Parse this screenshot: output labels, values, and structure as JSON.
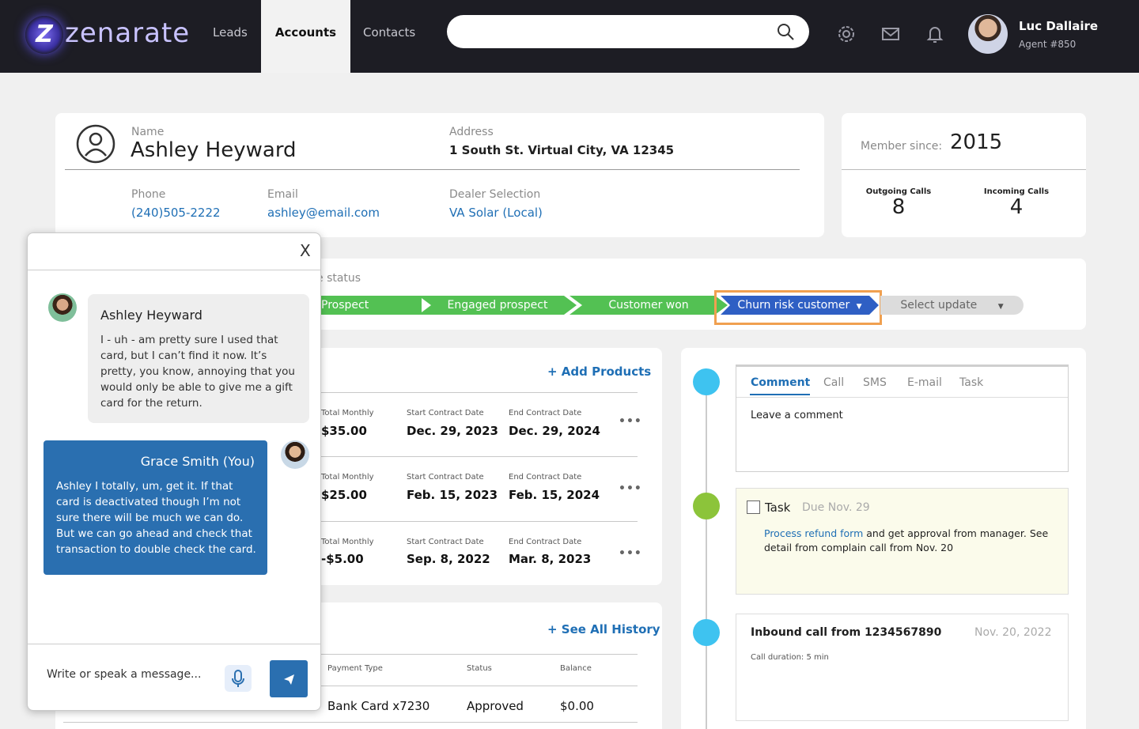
{
  "app": {
    "logo_letter": "Z",
    "name": "zenarate"
  },
  "nav": {
    "tabs": [
      "Leads",
      "Accounts",
      "Contacts"
    ],
    "active": "Accounts"
  },
  "search": {
    "placeholder": ""
  },
  "icons": {
    "search": "search-icon",
    "settings": "gear-icon",
    "mail": "mail-icon",
    "notifications": "bell-icon",
    "send": "send-icon",
    "mic": "microphone-icon",
    "more": "more-icon",
    "add": "plus-icon"
  },
  "user": {
    "name": "Luc Dallaire",
    "agent": "Agent #850"
  },
  "customer": {
    "name_label": "Name",
    "name": "Ashley Heyward",
    "address_label": "Address",
    "address": "1 South St. Virtual City, VA 12345",
    "phone_label": "Phone",
    "phone": "(240)505-2222",
    "email_label": "Email",
    "email": "ashley@email.com",
    "dealer_label": "Dealer Selection",
    "dealer": "VA Solar (Local)"
  },
  "stats": {
    "member_label": "Member since:",
    "member_year": "2015",
    "outgoing_label": "Outgoing Calls",
    "outgoing": "8",
    "incoming_label": "Incoming Calls",
    "incoming": "4"
  },
  "pipeline": {
    "label_fragment": "e status",
    "stages": [
      "Prospect",
      "Engaged prospect",
      "Customer won",
      "Churn risk customer",
      "Select update"
    ]
  },
  "products": {
    "add_label": "Add Products",
    "rows": [
      {
        "monthly_label": "Total Monthly",
        "monthly": "$35.00",
        "start_label": "Start Contract Date",
        "start": "Dec. 29, 2023",
        "end_label": "End Contract Date",
        "end": "Dec. 29, 2024"
      },
      {
        "monthly_label": "Total Monthly",
        "monthly": "$25.00",
        "start_label": "Start Contract Date",
        "start": "Feb. 15, 2023",
        "end_label": "End Contract Date",
        "end": "Feb. 15, 2024"
      },
      {
        "monthly_label": "Total Monthly",
        "monthly": "-$5.00",
        "start_label": "Start Contract Date",
        "start": "Sep. 8, 2022",
        "end_label": "End Contract Date",
        "end": "Mar. 8, 2023"
      }
    ]
  },
  "history": {
    "see_all": "See All History",
    "headers": [
      "Payment Type",
      "Status",
      "Balance"
    ],
    "row": [
      "Bank Card x7230",
      "Approved",
      "$0.00"
    ]
  },
  "activity": {
    "tabs": [
      "Comment",
      "Call",
      "SMS",
      "E-mail",
      "Task"
    ],
    "active_tab": "Comment",
    "comment_placeholder": "Leave a comment",
    "task": {
      "title": "Task",
      "due": "Due Nov. 29",
      "link": "Process refund form",
      "text": "and get approval from manager. See detail from complain call from Nov. 20"
    },
    "call": {
      "title": "Inbound call from 1234567890",
      "date": "Nov. 20, 2022",
      "duration": "Call duration: 5 min"
    }
  },
  "chat": {
    "close": "X",
    "customer_name": "Ashley Heyward",
    "customer_msg": "I - uh - am pretty sure I used that card, but I can’t find it now. It’s pretty, you know, annoying that you would only be able to give me a gift card for the return.",
    "agent_name": "Grace Smith (You)",
    "agent_msg": "Ashley I totally, um, get it. If that card is deactivated though I’m not sure there will be much we can do. But we can go ahead and check that transaction to double check the card.",
    "input_placeholder": "Write or speak a message..."
  },
  "colors": {
    "brand_dark": "#1d1d24",
    "accent_blue": "#1f6fb5",
    "stage_green": "#53c153",
    "stage_active": "#2f5fc4",
    "highlight": "#f0a050",
    "chat_agent_bg": "#2a6fb0",
    "timeline_blue": "#3ec3f0",
    "timeline_green": "#8cc43a",
    "task_bg": "#fbfbeb"
  }
}
